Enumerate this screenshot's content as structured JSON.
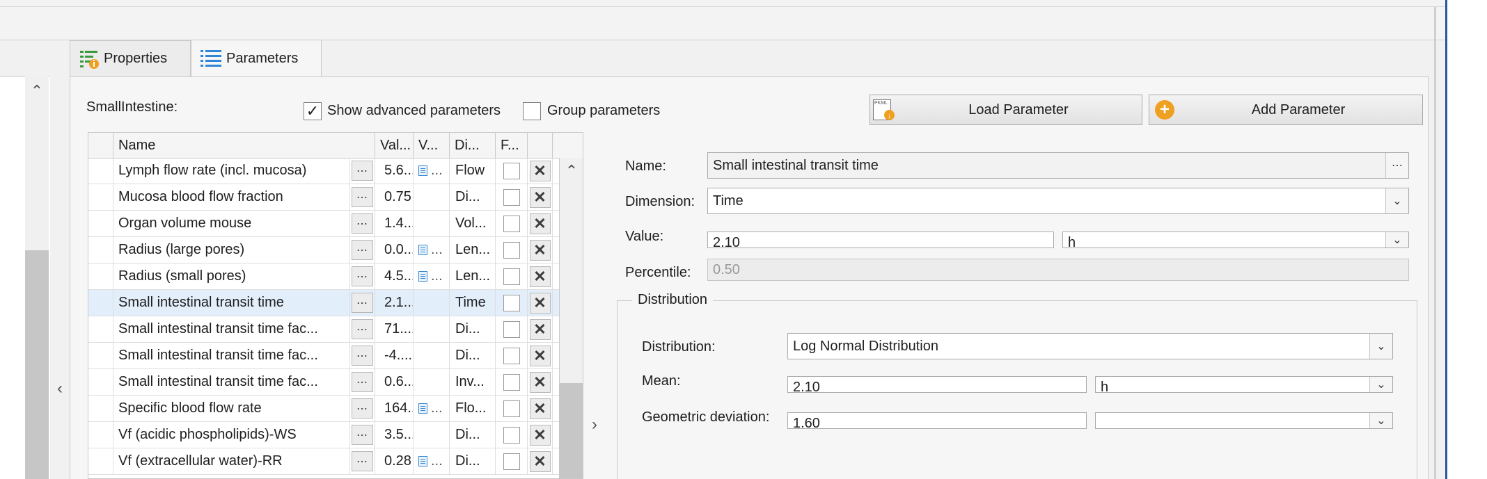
{
  "tabs": [
    {
      "label": "Properties",
      "icon": "properties-icon"
    },
    {
      "label": "Parameters",
      "icon": "parameters-icon",
      "active": true
    }
  ],
  "container_label": "SmallIntestine:",
  "options": {
    "show_advanced": {
      "label": "Show advanced parameters",
      "checked": true
    },
    "group_parameters": {
      "label": "Group parameters",
      "checked": false
    }
  },
  "buttons": {
    "load_parameter": "Load Parameter",
    "load_icon_text": "PKML",
    "add_parameter": "Add Parameter"
  },
  "grid": {
    "columns": [
      "Name",
      "Val...",
      "V...",
      "Di...",
      "F..."
    ],
    "rows": [
      {
        "name": "Lymph flow rate (incl. mucosa)",
        "value": "5.6...",
        "source": "...",
        "has_source": true,
        "dimension": "Flow"
      },
      {
        "name": "Mucosa blood flow fraction",
        "value": "0.75",
        "source": "",
        "has_source": false,
        "dimension": "Di..."
      },
      {
        "name": "Organ volume mouse",
        "value": "1.4...",
        "source": "",
        "has_source": false,
        "dimension": "Vol..."
      },
      {
        "name": "Radius (large pores)",
        "value": "0.0...",
        "source": "...",
        "has_source": true,
        "dimension": "Len..."
      },
      {
        "name": "Radius (small pores)",
        "value": "4.5...",
        "source": "...",
        "has_source": true,
        "dimension": "Len..."
      },
      {
        "name": "Small intestinal transit time",
        "value": "2.1...",
        "source": "",
        "has_source": false,
        "dimension": "Time",
        "selected": true
      },
      {
        "name": "Small intestinal transit time fac...",
        "value": "71....",
        "source": "",
        "has_source": false,
        "dimension": "Di..."
      },
      {
        "name": "Small intestinal transit time fac...",
        "value": "-4....",
        "source": "",
        "has_source": false,
        "dimension": "Di..."
      },
      {
        "name": "Small intestinal transit time fac...",
        "value": "0.6...",
        "source": "",
        "has_source": false,
        "dimension": "Inv..."
      },
      {
        "name": "Specific blood flow rate",
        "value": "164...",
        "source": "...",
        "has_source": true,
        "dimension": "Flo..."
      },
      {
        "name": "Vf (acidic phospholipids)-WS",
        "value": "3.5...",
        "source": "",
        "has_source": false,
        "dimension": "Di..."
      },
      {
        "name": "Vf (extracellular water)-RR",
        "value": "0.28",
        "source": "...",
        "has_source": true,
        "dimension": "Di..."
      }
    ]
  },
  "details": {
    "name_label": "Name:",
    "name_value": "Small intestinal transit time",
    "dimension_label": "Dimension:",
    "dimension_value": "Time",
    "value_label": "Value:",
    "value_value": "2.10",
    "value_unit": "h",
    "percentile_label": "Percentile:",
    "percentile_value": "0.50"
  },
  "distribution": {
    "group_title": "Distribution",
    "distribution_label": "Distribution:",
    "distribution_value": "Log Normal Distribution",
    "mean_label": "Mean:",
    "mean_value": "2.10",
    "mean_unit": "h",
    "geo_label": "Geometric deviation:",
    "geo_value": "1.60",
    "geo_unit": ""
  },
  "colors": {
    "accent": "#2b579a",
    "selected_row": "#e3eefb",
    "add_icon": "#f0a020"
  }
}
